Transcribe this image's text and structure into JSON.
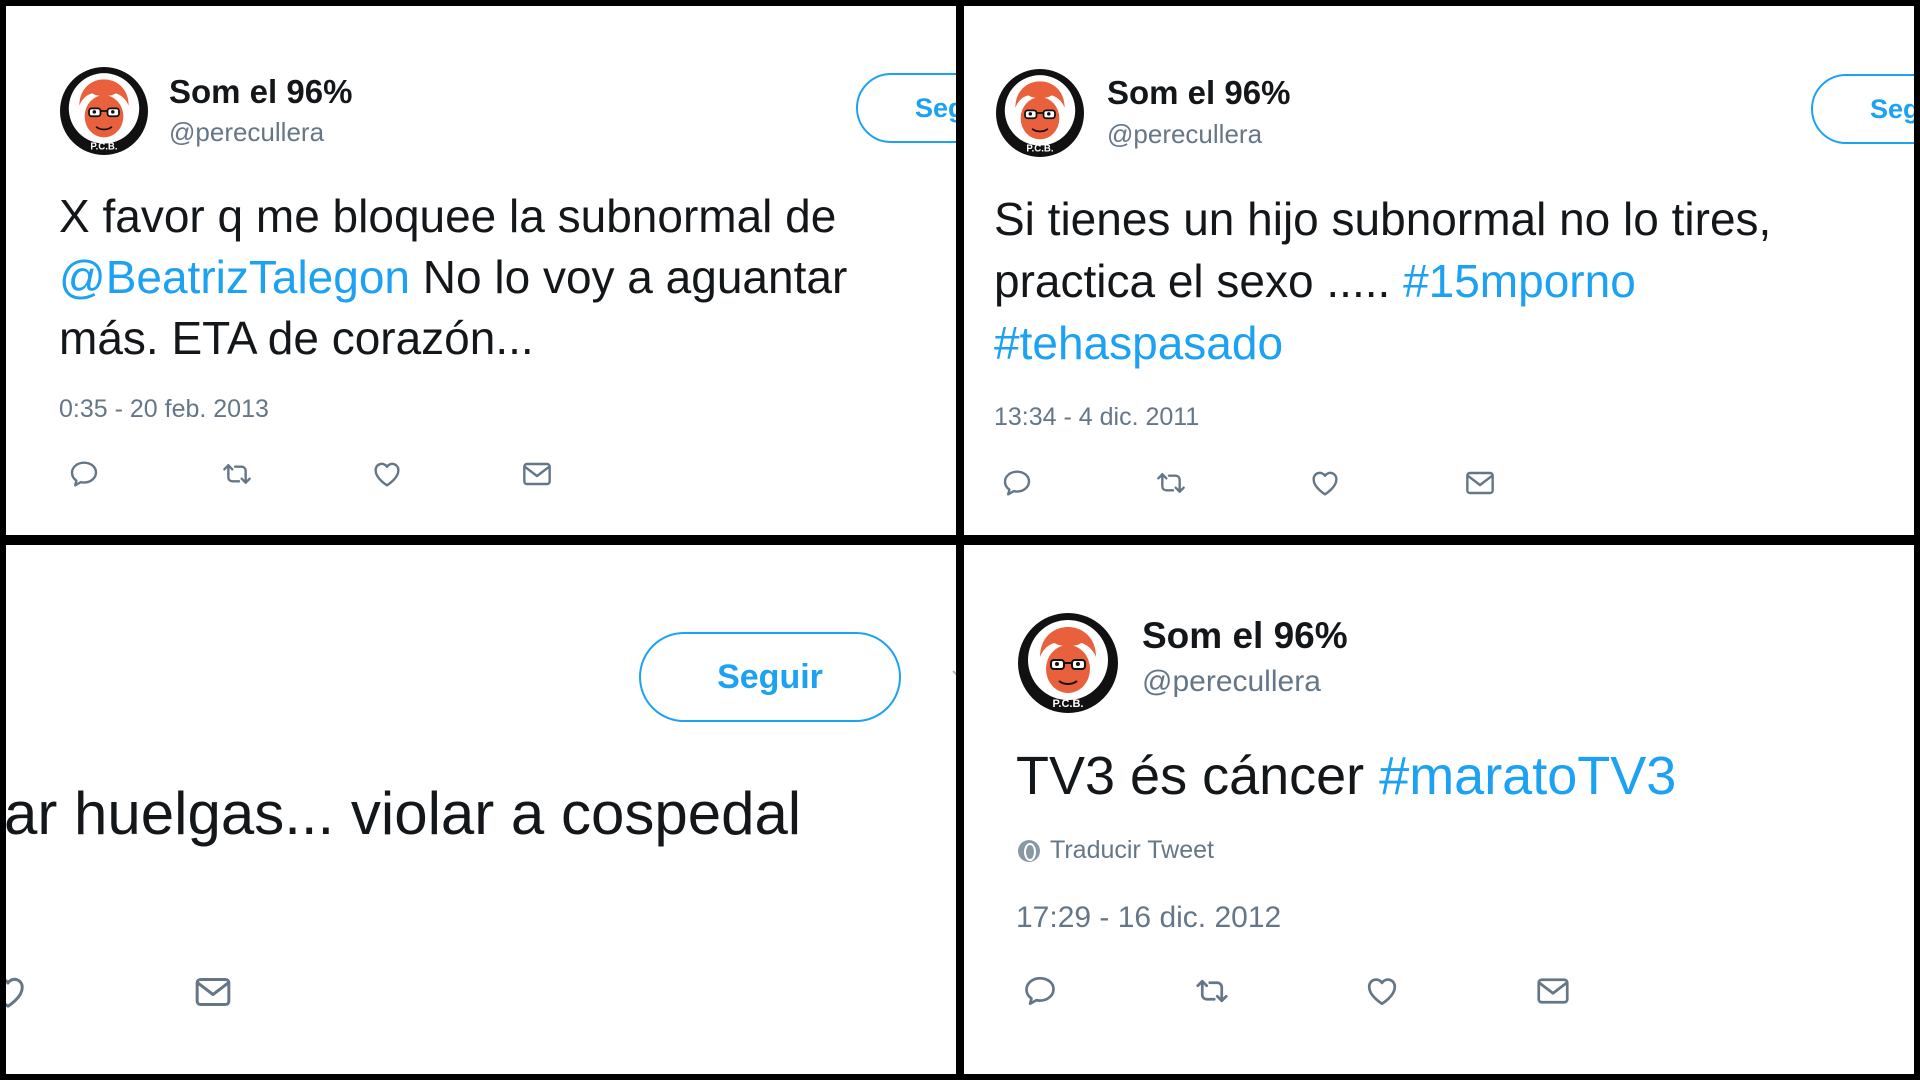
{
  "tweets": [
    {
      "author": "Som el 96%",
      "handle": "@perecullera",
      "follow_label": "Seg",
      "text_line1": "X favor q me bloquee la subnormal de",
      "mention": "@BeatrizTalegon",
      "text_line2_rest": " No lo voy a aguantar",
      "text_line3": "más. ETA de corazón...",
      "timestamp": "0:35 - 20 feb. 2013"
    },
    {
      "author": "Som el 96%",
      "handle": "@perecullera",
      "follow_label": "Seg",
      "text_line1": "Si tienes un hijo subnormal no lo tires,",
      "text_line2": "practica el sexo ..... ",
      "hashtag1": "#15mporno",
      "hashtag2": "#tehaspasado",
      "timestamp": "13:34 - 4 dic. 2011"
    },
    {
      "follow_label": "Seguir",
      "text": "ar huelgas... violar a cospedal"
    },
    {
      "author": "Som el 96%",
      "handle": "@perecullera",
      "text": "TV3 és cáncer ",
      "hashtag": "#maratoTV3",
      "translate_label": "Traducir Tweet",
      "timestamp": "17:29 - 16 dic. 2012"
    }
  ],
  "colors": {
    "link": "#1da1f2",
    "muted": "#657786",
    "text": "#14171a",
    "avatar_face": "#e8603c"
  },
  "icons": [
    "reply-icon",
    "retweet-icon",
    "like-icon",
    "direct-message-icon",
    "globe-icon"
  ]
}
